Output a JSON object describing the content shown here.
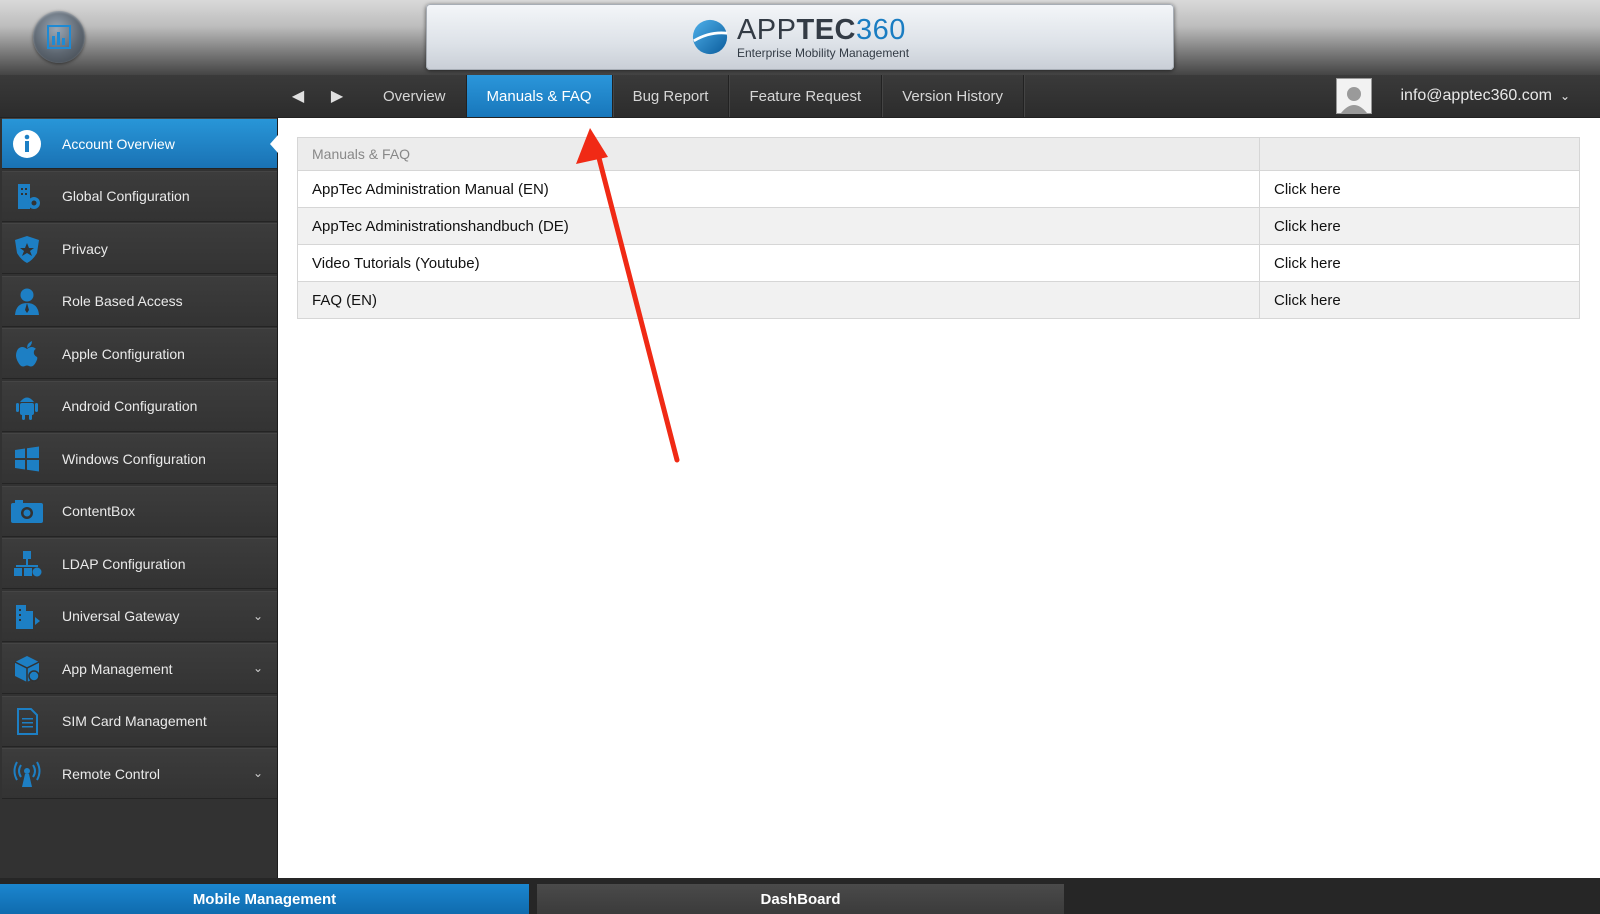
{
  "header": {
    "logo": {
      "brand_light": "APP",
      "brand_bold": "TEC",
      "brand_num": "360",
      "tagline": "Enterprise Mobility Management"
    },
    "home_icon": "bar-chart-icon"
  },
  "nav": {
    "back_glyph": "◀",
    "forward_glyph": "▶",
    "tabs": [
      {
        "label": "Overview"
      },
      {
        "label": "Manuals & FAQ",
        "active": true
      },
      {
        "label": "Bug Report"
      },
      {
        "label": "Feature Request"
      },
      {
        "label": "Version History"
      }
    ],
    "user": {
      "email": "info@apptec360.com",
      "avatar_icon": "user-avatar-icon"
    }
  },
  "sidebar": {
    "items": [
      {
        "label": "Account Overview",
        "icon": "info-icon",
        "active": true
      },
      {
        "label": "Global Configuration",
        "icon": "building-gear-icon"
      },
      {
        "label": "Privacy",
        "icon": "shield-star-icon"
      },
      {
        "label": "Role Based Access",
        "icon": "person-icon"
      },
      {
        "label": "Apple Configuration",
        "icon": "apple-icon"
      },
      {
        "label": "Android Configuration",
        "icon": "android-icon"
      },
      {
        "label": "Windows Configuration",
        "icon": "windows-icon"
      },
      {
        "label": "ContentBox",
        "icon": "camera-box-icon"
      },
      {
        "label": "LDAP Configuration",
        "icon": "ldap-tree-icon"
      },
      {
        "label": "Universal Gateway",
        "icon": "gateway-icon",
        "expandable": true
      },
      {
        "label": "App Management",
        "icon": "app-box-icon",
        "expandable": true
      },
      {
        "label": "SIM Card Management",
        "icon": "document-icon"
      },
      {
        "label": "Remote Control",
        "icon": "antenna-icon",
        "expandable": true
      }
    ]
  },
  "faq_table": {
    "header": "Manuals & FAQ",
    "header_col2": "",
    "rows": [
      {
        "title": "AppTec Administration Manual (EN)",
        "link": "Click here"
      },
      {
        "title": "AppTec Administrationshandbuch (DE)",
        "link": "Click here"
      },
      {
        "title": "Video Tutorials (Youtube)",
        "link": "Click here"
      },
      {
        "title": "FAQ (EN)",
        "link": "Click here"
      }
    ]
  },
  "footer": {
    "tabs": [
      {
        "label": "Mobile Management",
        "active": true
      },
      {
        "label": "DashBoard"
      }
    ]
  },
  "colors": {
    "accent": "#1a7dc2",
    "annotation_arrow": "#f02a15",
    "sidebar_bg": "#323232"
  }
}
